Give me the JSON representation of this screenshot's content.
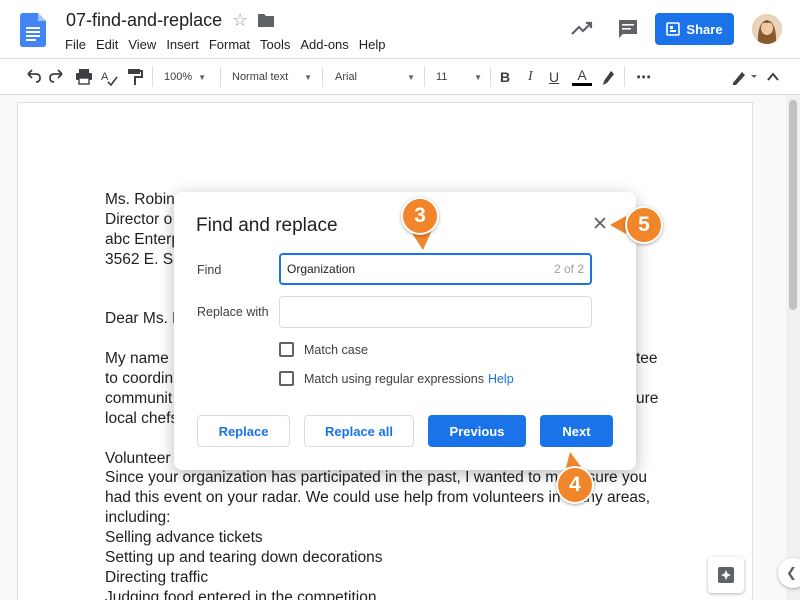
{
  "header": {
    "doc_title": "07-find-and-replace",
    "share_label": "Share",
    "menu": [
      "File",
      "Edit",
      "View",
      "Insert",
      "Format",
      "Tools",
      "Add-ons",
      "Help"
    ]
  },
  "toolbar": {
    "zoom": "100%",
    "style": "Normal text",
    "font": "Arial",
    "font_size": "11",
    "bold": "B",
    "italic": "I",
    "underline": "U",
    "text_color": "A",
    "more": "⋯"
  },
  "document": {
    "lines": [
      "Ms. Robin",
      "Director o",
      "abc Enterp",
      "3562 E. Sh",
      "",
      "",
      "Dear Ms. E",
      "",
      "My name",
      "to coordin",
      "communit",
      "local chefs",
      "",
      "Volunteer",
      "Since your organization has participated in the past, I wanted to make sure you",
      "had this event on your radar. We could use help from volunteers in many areas,",
      "including:",
      "Selling advance tickets",
      "Setting up and tearing down decorations",
      "Directing traffic",
      "Judging food entered in the competition"
    ],
    "right_fragments": [
      {
        "line": 8,
        "text": "tee"
      },
      {
        "line": 10,
        "text": "ure"
      }
    ]
  },
  "dialog": {
    "title": "Find and replace",
    "find_label": "Find",
    "find_value": "Organization",
    "find_count": "2 of 2",
    "replace_label": "Replace with",
    "replace_value": "",
    "match_case_label": "Match case",
    "regex_label": "Match using regular expressions",
    "help_label": "Help",
    "replace_btn": "Replace",
    "replace_all_btn": "Replace all",
    "previous_btn": "Previous",
    "next_btn": "Next"
  },
  "callouts": [
    "3",
    "4",
    "5"
  ],
  "colors": {
    "accent": "#1a73e8",
    "callout": "#f0852a"
  }
}
